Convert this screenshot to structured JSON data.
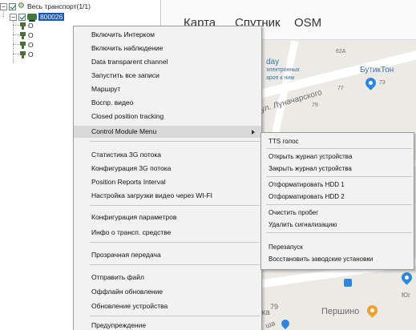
{
  "tree": {
    "root_label": "Весь транспорт(1/1)",
    "node_label": "800026",
    "child_prefix": "O",
    "child_count": 4
  },
  "map": {
    "tabs": [
      "Карта",
      "Спутник",
      "OSM"
    ],
    "labels": {
      "place_62a": "62A",
      "day": "day",
      "electronics": "электронных",
      "near": "ароп к ним",
      "boutique": "БутикТон",
      "num_73": "73",
      "num_77": "77",
      "num_79": "79",
      "street": "ул. Луначарского",
      "num_79b": "79",
      "ika": "ика",
      "pershino": "Першино",
      "yug": "Юг",
      "sha": "ша"
    }
  },
  "context_menu": {
    "items": [
      "Включить Интерком",
      "Включить наблюдение",
      "Data transparent channel",
      "Запустить все записи",
      "Маршрут",
      "Воспр. видео",
      "Closed position tracking",
      "Control Module Menu",
      "Статистика 3G потока",
      "Конфигурация 3G потока",
      "Position Reports Interval",
      "Настройка загрузки видео через WI-FI",
      "Конфигурация параметров",
      "Инфо о трансп. средстве",
      "Прозрачная передача",
      "Отправить файл",
      "Оффлайн обновление",
      "Обновление устройства",
      "Предупреждение"
    ],
    "highlighted_index": 7
  },
  "submenu": {
    "items": [
      "TTS голос",
      "Открыть журнал устройства",
      "Закрыть журнал устройства",
      "Отформатировать HDD 1",
      "Отформатировать HDD 2",
      "Очистить пробег",
      "Удалить сигнализацию",
      "Перезапуск",
      "Восстановить заводские установки"
    ]
  },
  "colors": {
    "selection": "#1f55b5",
    "menu_bg": "#f2f2f2",
    "menu_highlight": "#d9d9d9",
    "map_bg": "#eceae4",
    "pin_blue": "#2e86de",
    "pin_orange": "#f0a030"
  }
}
